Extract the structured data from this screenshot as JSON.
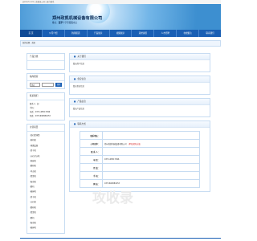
{
  "topbar": {
    "text": "ganxuh.com | 欢迎来公司 | 进行联系"
  },
  "header": {
    "company_name": "郑州政凯机械设备有限公司",
    "slogan_prefix": "推标：",
    "slogan_bold": "菠萝",
    "slogan_rest": "十字型摆辊水之"
  },
  "nav": {
    "items": [
      {
        "label": "首 页",
        "active": true
      },
      {
        "label": "公司介绍"
      },
      {
        "label": "新闻报道"
      },
      {
        "label": "产品展示"
      },
      {
        "label": "视频展示"
      },
      {
        "label": "荣誉资质"
      },
      {
        "label": "人才招聘"
      },
      {
        "label": "在线留言"
      },
      {
        "label": "联系我们"
      }
    ]
  },
  "breadcrumb": {
    "text": "您的位置：首页"
  },
  "sidebar": {
    "product_category_title": "产品分类",
    "search_title": "站内搜索",
    "search_select": "供应",
    "search_button": "搜索",
    "contact_title": "联系我们",
    "contact_lines": [
      "联系人：赵",
      "手机：",
      "电话：0371-68517996",
      "传真：0371690884253"
    ],
    "products_title": "主营项目",
    "product_items": [
      "蓝石墨球墨",
      "粉机机",
      "球磨设备",
      "烘干机",
      "沙石打沙机",
      "粉碎机",
      "磨粉机",
      "冲击机",
      "雷蒙机",
      "振动机",
      "磨机",
      "破碎机",
      "烘干机",
      "沙石机",
      "磨粉机",
      "雷蒙机",
      "磨机",
      "振动机",
      "破碎机"
    ]
  },
  "main": {
    "about_title": "关于我们",
    "about_text": "暂无简介信息",
    "supply_title": "供应信息",
    "supply_text": "暂无供应信息",
    "products_title": "产品信息",
    "products_text": "暂无产品信息",
    "contact_title": "联系方式",
    "contact_table": [
      {
        "label": "联系地址：",
        "value": "",
        "note": ""
      },
      {
        "label": "公司名称：",
        "value": "郑州政凯机械设备有限公司",
        "note": "（单位实际认证）"
      },
      {
        "label": "联 系 人：",
        "value": "",
        "note": ""
      },
      {
        "label": "电    话：",
        "value": "0371-68517996",
        "note": ""
      },
      {
        "label": "传    真：",
        "value": "",
        "note": ""
      },
      {
        "label": "手    机：",
        "value": "",
        "note": ""
      },
      {
        "label": "网    站：",
        "value": "0371690884253",
        "note": ""
      }
    ]
  },
  "watermark": "攻收录",
  "colors": {
    "nav_blue": "#1a5fb4",
    "border_blue": "#c7dcf2",
    "note_red": "#cc0000"
  }
}
